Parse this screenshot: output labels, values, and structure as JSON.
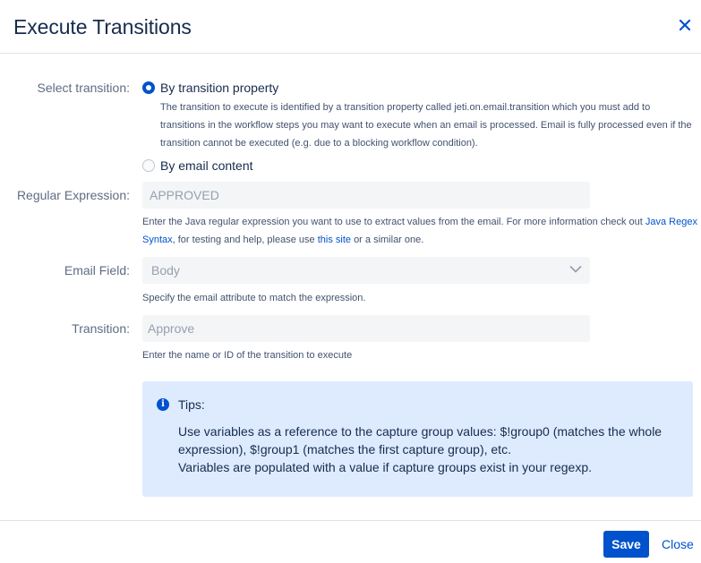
{
  "dialog": {
    "title": "Execute Transitions",
    "close_icon": "close-icon"
  },
  "select_transition": {
    "label": "Select transition:",
    "options": [
      {
        "label": "By transition property",
        "checked": true
      },
      {
        "label": "By email content",
        "checked": false
      }
    ],
    "help": "The transition to execute is identified by a transition property called jeti.on.email.transition which you must add to transitions in the workflow steps you may want to execute when an email is processed. Email is fully processed even if the transition cannot be executed (e.g. due to a blocking workflow condition)."
  },
  "regex": {
    "label": "Regular Expression:",
    "value": "APPROVED",
    "help_prefix": "Enter the Java regular expression you want to use to extract values from the email. For more information check out",
    "link1": "Java Regex Syntax",
    "help_middle": ", for testing and help, please use",
    "link2": "this site",
    "help_suffix": "or a similar one."
  },
  "email_field": {
    "label": "Email Field:",
    "value": "Body",
    "help": "Specify the email attribute to match the expression.",
    "icon": "chevron-down-icon"
  },
  "transition": {
    "label": "Transition:",
    "placeholder": "Approve",
    "help": "Enter the name or ID of the transition to execute"
  },
  "tips": {
    "icon": "info-icon",
    "title": "Tips:",
    "line1": "Use variables as a reference to the capture group values: $!group0 (matches the whole expression), $!group1 (matches the first capture group), etc.",
    "line2": "Variables are populated with a value if capture groups exist in your regexp."
  },
  "footer": {
    "save_label": "Save",
    "close_label": "Close"
  },
  "colors": {
    "primary": "#0052cc",
    "info_bg": "#deebff",
    "field_bg": "#f4f5f7"
  }
}
